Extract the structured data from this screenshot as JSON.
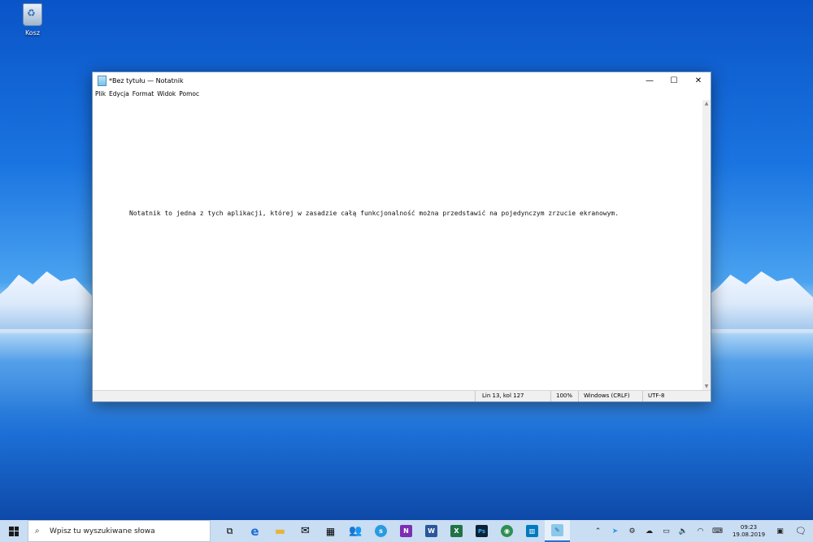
{
  "desktop": {
    "recycle_bin_label": "Kosz"
  },
  "window": {
    "title": "*Bez tytułu — Notatnik",
    "controls": {
      "minimize": "—",
      "maximize": "☐",
      "close": "✕"
    },
    "menu": [
      "Plik",
      "Edycja",
      "Format",
      "Widok",
      "Pomoc"
    ],
    "content": "Notatnik to jedna z tych aplikacji, której w zasadzie całą funkcjonalność można przedstawić na pojedynczym zrzucie ekranowym.",
    "status": {
      "position": "Lin 13, kol 127",
      "zoom": "100%",
      "line_endings": "Windows (CRLF)",
      "encoding": "UTF-8"
    }
  },
  "taskbar": {
    "search_placeholder": "Wpisz tu wyszukiwane słowa",
    "apps": [
      {
        "icon": "task-view-icon"
      },
      {
        "icon": "edge-icon",
        "color": "#1f6fd6"
      },
      {
        "icon": "file-explorer-icon",
        "color": "#f2c14e"
      },
      {
        "icon": "mail-icon"
      },
      {
        "icon": "calendar-icon"
      },
      {
        "icon": "people-icon"
      },
      {
        "icon": "skype-icon",
        "color": "#2b9be0"
      },
      {
        "icon": "onenote-icon",
        "color": "#7b2fb1",
        "letter": "N"
      },
      {
        "icon": "word-icon",
        "color": "#2b579a",
        "letter": "W"
      },
      {
        "icon": "excel-icon",
        "color": "#217346",
        "letter": "X"
      },
      {
        "icon": "photoshop-icon",
        "color": "#0b2235",
        "letter": "Ps"
      },
      {
        "icon": "chrome-icon",
        "color": "#2f8f52"
      },
      {
        "icon": "trello-icon",
        "color": "#0079bf"
      },
      {
        "icon": "notepad-icon",
        "color": "#8cc8ea"
      }
    ],
    "clock": {
      "time": "09:23",
      "date": "19.08.2019"
    }
  },
  "colors": {
    "accent": "#2b6fd1",
    "taskbar": "#c9ddf3"
  }
}
